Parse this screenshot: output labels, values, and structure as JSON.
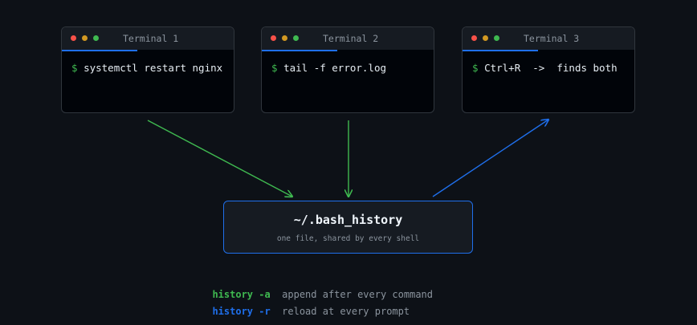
{
  "colors": {
    "background": "#0d1117",
    "terminal_body": "#010409",
    "titlebar": "#161b22",
    "border": "#30363d",
    "dot_red": "#f85149",
    "dot_yellow": "#d29922",
    "dot_green": "#3fb950",
    "accent_blue": "#1f6feb",
    "accent_green": "#3fb950",
    "prompt_green": "#3fb950"
  },
  "terminals": [
    {
      "title": "Terminal 1",
      "prompt": "$",
      "command": "systemctl restart nginx"
    },
    {
      "title": "Terminal 2",
      "prompt": "$",
      "command": "tail -f error.log"
    },
    {
      "title": "Terminal 3",
      "prompt": "$",
      "command": "Ctrl+R  ->  finds both"
    }
  ],
  "history_file": {
    "title": "~/.bash_history",
    "subtitle": "one file, shared by every shell"
  },
  "legend": [
    {
      "command": "history -a",
      "description": "append after every command",
      "color": "#3fb950"
    },
    {
      "command": "history -r",
      "description": "reload at every prompt",
      "color": "#1f6feb"
    }
  ]
}
